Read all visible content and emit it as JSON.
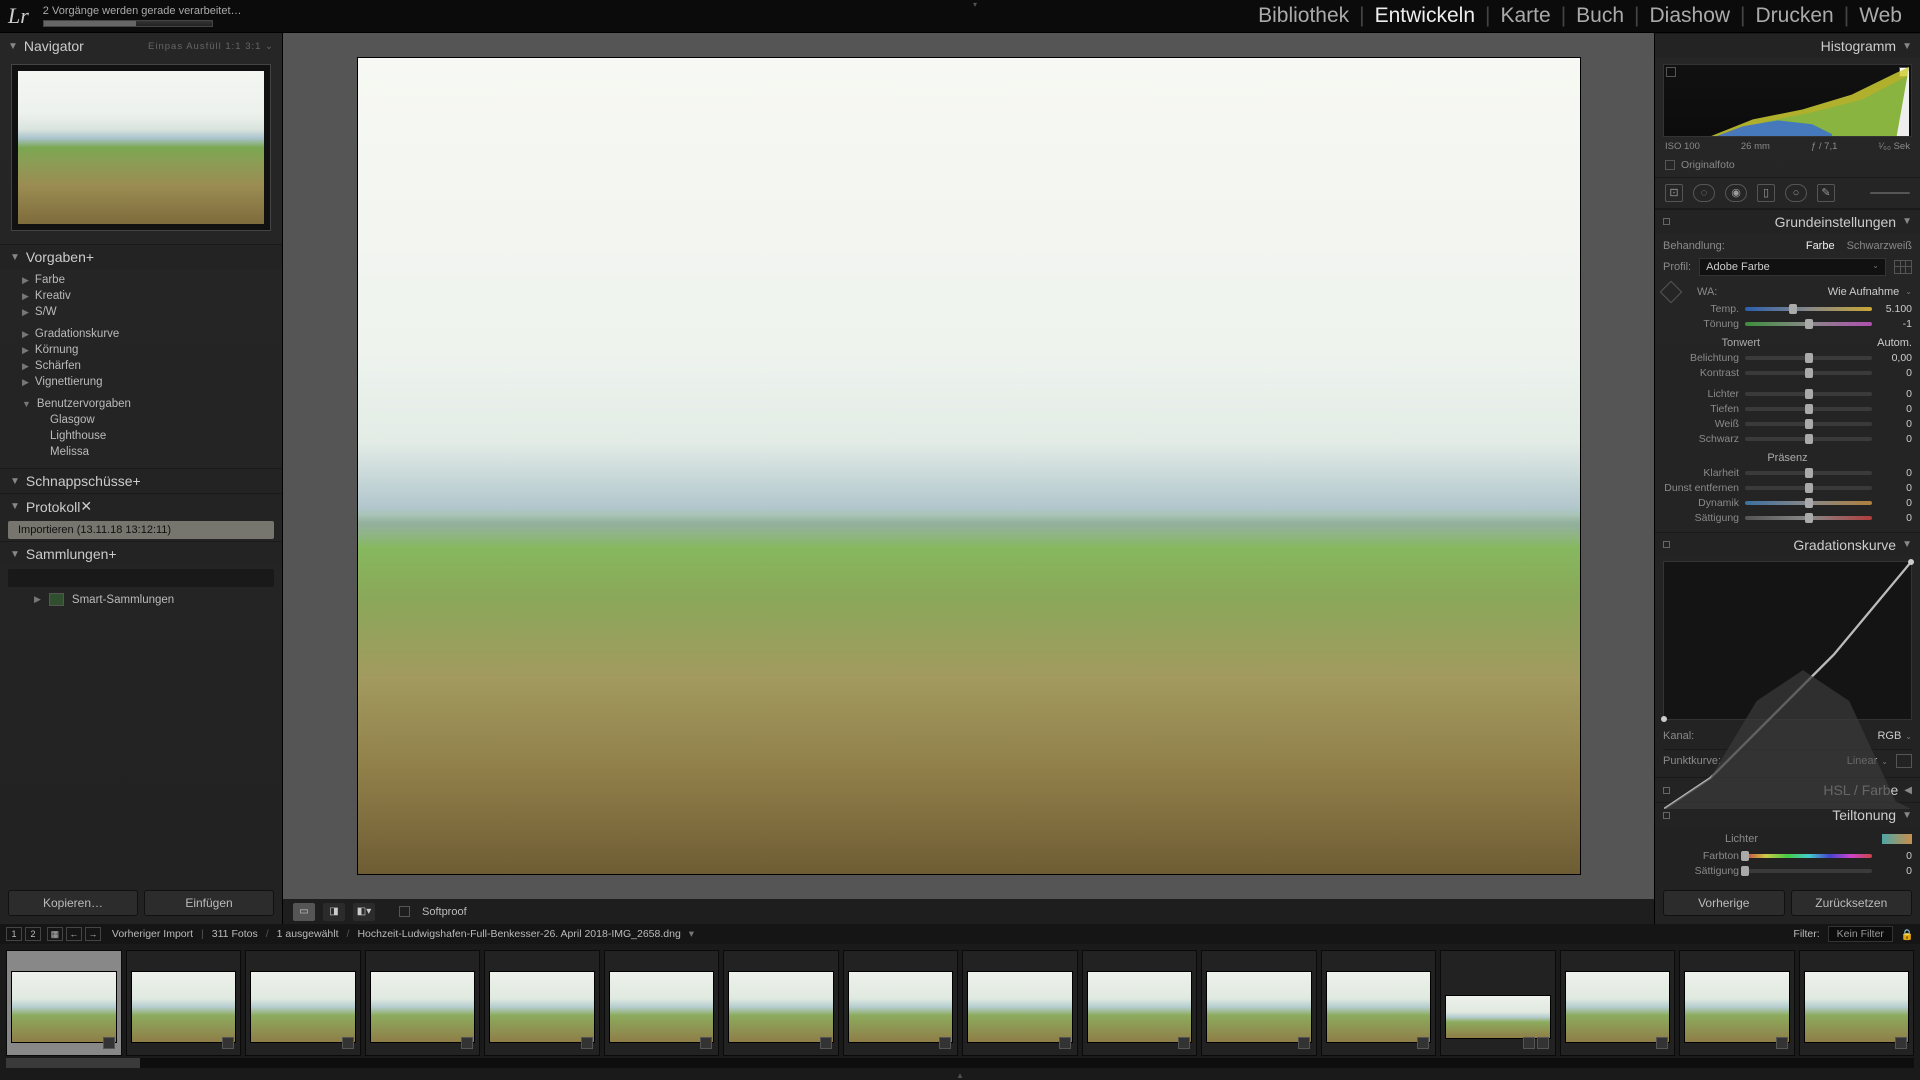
{
  "status_text": "2 Vorgänge werden gerade verarbeitet…",
  "modules": {
    "items": [
      "Bibliothek",
      "Entwickeln",
      "Karte",
      "Buch",
      "Diashow",
      "Drucken",
      "Web"
    ],
    "active": "Entwickeln"
  },
  "left": {
    "navigator": {
      "title": "Navigator",
      "zoom_labels": "Einpas   Ausfüll   1:1   3:1  ⌄"
    },
    "presets": {
      "title": "Vorgaben",
      "items": [
        "Farbe",
        "Kreativ",
        "S/W"
      ],
      "items2": [
        "Gradationskurve",
        "Körnung",
        "Schärfen",
        "Vignettierung"
      ],
      "user_title": "Benutzervorgaben",
      "user_items": [
        "Glasgow",
        "Lighthouse",
        "Melissa"
      ]
    },
    "snapshots_title": "Schnappschüsse",
    "history": {
      "title": "Protokoll",
      "entry": "Importieren (13.11.18 13:12:11)"
    },
    "collections": {
      "title": "Sammlungen",
      "smart": "Smart-Sammlungen"
    },
    "btn_copy": "Kopieren…",
    "btn_paste": "Einfügen"
  },
  "toolbar": {
    "softproof": "Softproof"
  },
  "infobar": {
    "context": "Vorheriger Import",
    "count": "311 Fotos",
    "selected": "1 ausgewählt",
    "filename": "Hochzeit-Ludwigshafen-Full-Benkesser-26. April 2018-IMG_2658.dng",
    "filter_label": "Filter:",
    "filter_value": "Kein Filter"
  },
  "right": {
    "histogram_title": "Histogramm",
    "meta": {
      "iso": "ISO 100",
      "focal": "26 mm",
      "aperture": "ƒ / 7,1",
      "shutter": "¹⁄₆₀ Sek"
    },
    "original": "Originalfoto",
    "basic": {
      "title": "Grundeinstellungen",
      "treatment_label": "Behandlung:",
      "treatment_color": "Farbe",
      "treatment_bw": "Schwarzweiß",
      "profile_label": "Profil:",
      "profile_value": "Adobe Farbe",
      "wb_label": "WA:",
      "wb_value": "Wie Aufnahme",
      "temp_label": "Temp.",
      "temp_value": "5.100",
      "tint_label": "Tönung",
      "tint_value": "-1",
      "tone_label": "Tonwert",
      "auto_label": "Autom.",
      "exposure_label": "Belichtung",
      "exposure_value": "0,00",
      "contrast_label": "Kontrast",
      "contrast_value": "0",
      "highlights_label": "Lichter",
      "highlights_value": "0",
      "shadows_label": "Tiefen",
      "shadows_value": "0",
      "whites_label": "Weiß",
      "whites_value": "0",
      "blacks_label": "Schwarz",
      "blacks_value": "0",
      "presence_label": "Präsenz",
      "clarity_label": "Klarheit",
      "clarity_value": "0",
      "dehaze_label": "Dunst entfernen",
      "dehaze_value": "0",
      "vibrance_label": "Dynamik",
      "vibrance_value": "0",
      "saturation_label": "Sättigung",
      "saturation_value": "0"
    },
    "curve": {
      "title": "Gradationskurve",
      "channel_label": "Kanal:",
      "channel_value": "RGB",
      "pointcurve_label": "Punktkurve:",
      "pointcurve_value": "Linear"
    },
    "hsl_title": "HSL / Farbe",
    "split": {
      "title": "Teiltonung",
      "highlights": "Lichter",
      "hue_label": "Farbton",
      "hue_value": "0",
      "sat_label": "Sättigung",
      "sat_value": "0"
    },
    "btn_prev": "Vorherige",
    "btn_reset": "Zurücksetzen"
  }
}
